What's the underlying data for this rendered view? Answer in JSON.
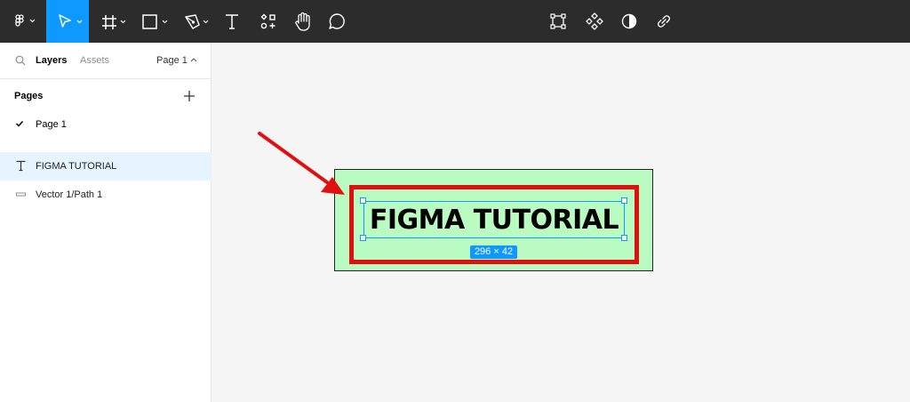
{
  "toolbar": {
    "tools": [
      {
        "name": "figma-menu",
        "active": false
      },
      {
        "name": "move-tool",
        "active": true
      },
      {
        "name": "frame-tool",
        "active": false
      },
      {
        "name": "shape-tool",
        "active": false
      },
      {
        "name": "pen-tool",
        "active": false
      },
      {
        "name": "text-tool",
        "active": false
      },
      {
        "name": "resources-tool",
        "active": false
      },
      {
        "name": "hand-tool",
        "active": false
      },
      {
        "name": "comment-tool",
        "active": false
      }
    ],
    "center_tools": [
      "edit-object-icon",
      "component-icon",
      "contrast-icon",
      "link-icon"
    ],
    "accent": "#0d99ff"
  },
  "panel": {
    "tabs": {
      "layers": "Layers",
      "assets": "Assets",
      "page": "Page 1"
    },
    "pages_title": "Pages",
    "pages": [
      {
        "label": "Page 1",
        "current": true
      }
    ],
    "layers": [
      {
        "label": "FIGMA TUTORIAL",
        "icon": "text-layer-icon",
        "selected": true
      },
      {
        "label": "Vector 1/Path 1",
        "icon": "vector-layer-icon",
        "selected": false
      }
    ]
  },
  "canvas": {
    "text": "FIGMA TUTORIAL",
    "size_label": "296 × 42",
    "frame_color": "#b9fbc0",
    "box_color": "#e01010",
    "arrow_color": "#e01010"
  }
}
